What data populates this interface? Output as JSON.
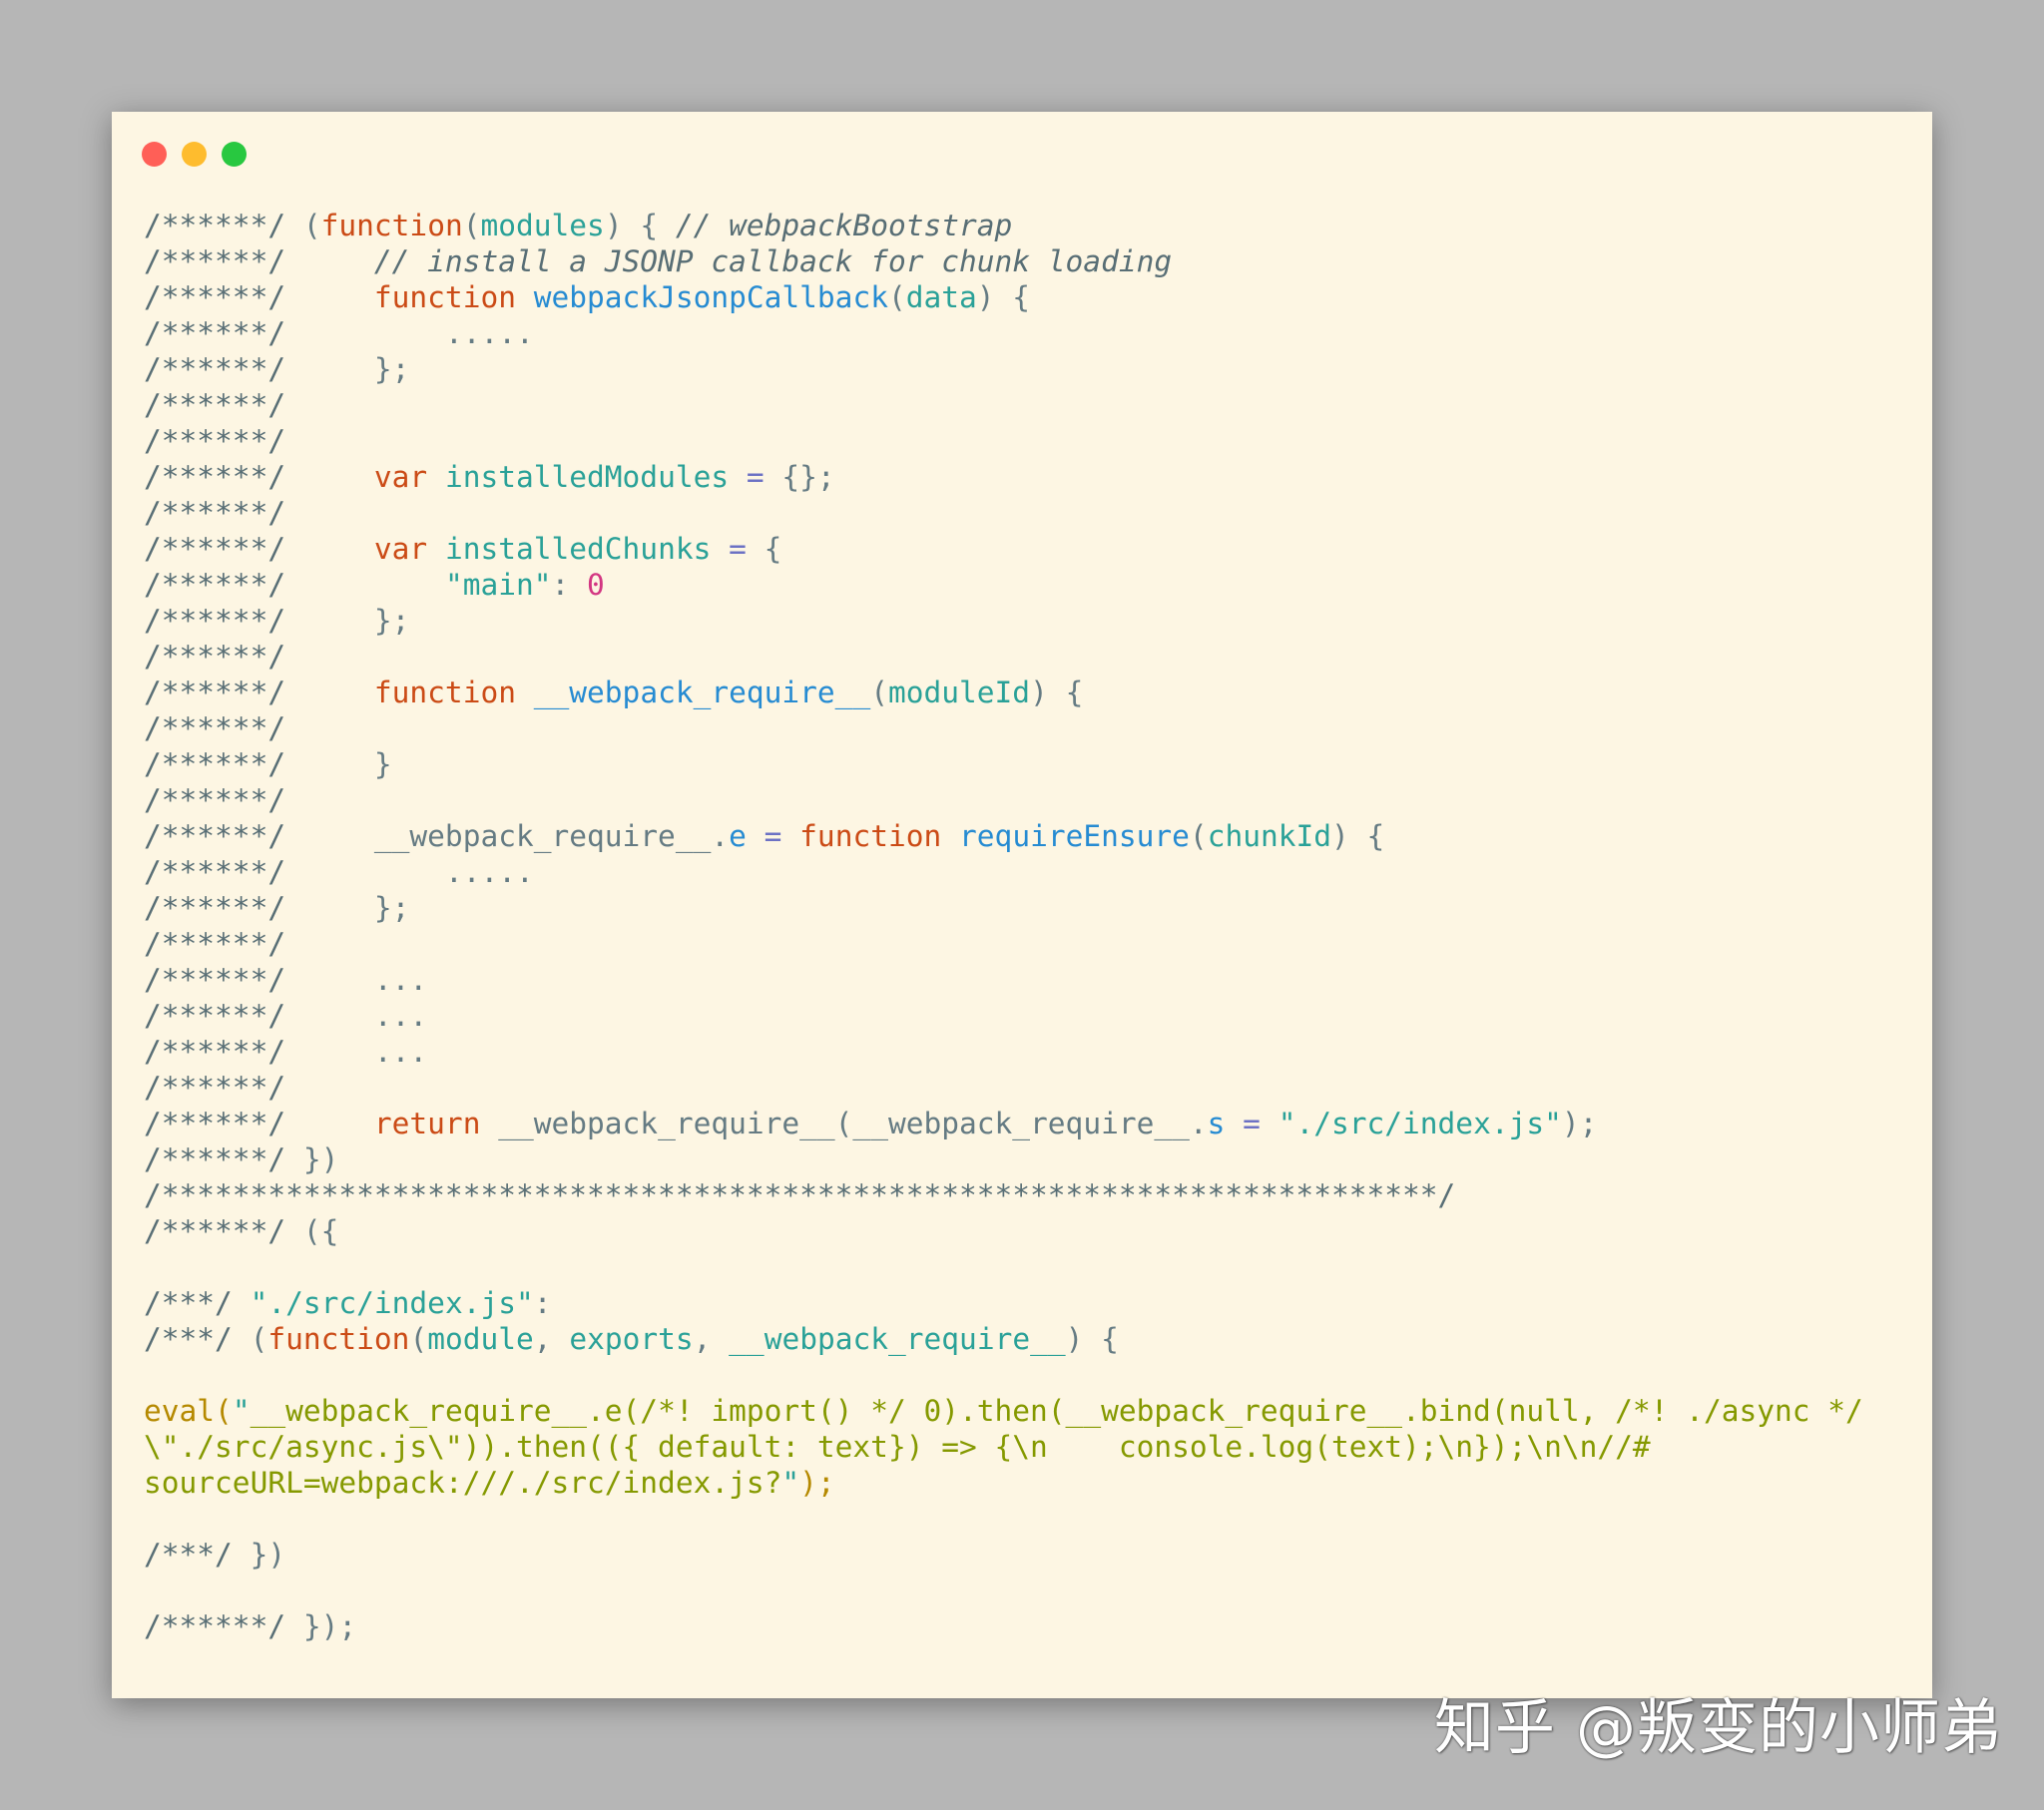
{
  "window": {
    "traffic_lights": [
      {
        "name": "close",
        "color": "#ff5f57"
      },
      {
        "name": "minimize",
        "color": "#febc2e"
      },
      {
        "name": "zoom",
        "color": "#28c840"
      }
    ]
  },
  "code_lines": [
    [
      [
        "c",
        "/******/ "
      ],
      [
        "p",
        "("
      ],
      [
        "k",
        "function"
      ],
      [
        "p",
        "("
      ],
      [
        "v",
        "modules"
      ],
      [
        "p",
        ") { "
      ],
      [
        "ci",
        "// webpackBootstrap"
      ]
    ],
    [
      [
        "c",
        "/******/     "
      ],
      [
        "ci",
        "// install a JSONP callback for chunk loading"
      ]
    ],
    [
      [
        "c",
        "/******/     "
      ],
      [
        "k",
        "function "
      ],
      [
        "f",
        "webpackJsonpCallback"
      ],
      [
        "p",
        "("
      ],
      [
        "v",
        "data"
      ],
      [
        "p",
        ") {"
      ]
    ],
    [
      [
        "c",
        "/******/         "
      ],
      [
        "p",
        "....."
      ]
    ],
    [
      [
        "c",
        "/******/     "
      ],
      [
        "p",
        "};"
      ]
    ],
    [
      [
        "c",
        "/******/"
      ]
    ],
    [
      [
        "c",
        "/******/"
      ]
    ],
    [
      [
        "c",
        "/******/     "
      ],
      [
        "k",
        "var "
      ],
      [
        "v",
        "installedModules"
      ],
      [
        "o",
        " = "
      ],
      [
        "p",
        "{};"
      ]
    ],
    [
      [
        "c",
        "/******/"
      ]
    ],
    [
      [
        "c",
        "/******/     "
      ],
      [
        "k",
        "var "
      ],
      [
        "v",
        "installedChunks"
      ],
      [
        "o",
        " = "
      ],
      [
        "p",
        "{"
      ]
    ],
    [
      [
        "c",
        "/******/         "
      ],
      [
        "s",
        "\"main\""
      ],
      [
        "p",
        ": "
      ],
      [
        "n",
        "0"
      ]
    ],
    [
      [
        "c",
        "/******/     "
      ],
      [
        "p",
        "};"
      ]
    ],
    [
      [
        "c",
        "/******/"
      ]
    ],
    [
      [
        "c",
        "/******/     "
      ],
      [
        "k",
        "function "
      ],
      [
        "f",
        "__webpack_require__"
      ],
      [
        "p",
        "("
      ],
      [
        "v",
        "moduleId"
      ],
      [
        "p",
        ") {"
      ]
    ],
    [
      [
        "c",
        "/******/"
      ]
    ],
    [
      [
        "c",
        "/******/     "
      ],
      [
        "p",
        "}"
      ]
    ],
    [
      [
        "c",
        "/******/"
      ]
    ],
    [
      [
        "c",
        "/******/     "
      ],
      [
        "p",
        "__webpack_require__."
      ],
      [
        "f",
        "e"
      ],
      [
        "o",
        " = "
      ],
      [
        "k",
        "function "
      ],
      [
        "f",
        "requireEnsure"
      ],
      [
        "p",
        "("
      ],
      [
        "v",
        "chunkId"
      ],
      [
        "p",
        ") {"
      ]
    ],
    [
      [
        "c",
        "/******/         "
      ],
      [
        "p",
        "....."
      ]
    ],
    [
      [
        "c",
        "/******/     "
      ],
      [
        "p",
        "};"
      ]
    ],
    [
      [
        "c",
        "/******/"
      ]
    ],
    [
      [
        "c",
        "/******/     "
      ],
      [
        "p",
        "..."
      ]
    ],
    [
      [
        "c",
        "/******/     "
      ],
      [
        "p",
        "..."
      ]
    ],
    [
      [
        "c",
        "/******/     "
      ],
      [
        "p",
        "..."
      ]
    ],
    [
      [
        "c",
        "/******/"
      ]
    ],
    [
      [
        "c",
        "/******/     "
      ],
      [
        "k",
        "return "
      ],
      [
        "p",
        "__webpack_require__(__webpack_require__."
      ],
      [
        "f",
        "s"
      ],
      [
        "o",
        " = "
      ],
      [
        "s",
        "\"./src/index.js\""
      ],
      [
        "p",
        ");"
      ]
    ],
    [
      [
        "c",
        "/******/ "
      ],
      [
        "p",
        "})"
      ]
    ],
    [
      [
        "c",
        "/************************************************************************/"
      ]
    ],
    [
      [
        "c",
        "/******/ "
      ],
      [
        "p",
        "({"
      ]
    ],
    [],
    [
      [
        "c",
        "/***/ "
      ],
      [
        "s",
        "\"./src/index.js\""
      ],
      [
        "p",
        ":"
      ]
    ],
    [
      [
        "c",
        "/***/ "
      ],
      [
        "p",
        "("
      ],
      [
        "k",
        "function"
      ],
      [
        "p",
        "("
      ],
      [
        "v",
        "module"
      ],
      [
        "p",
        ", "
      ],
      [
        "v",
        "exports"
      ],
      [
        "p",
        ", "
      ],
      [
        "v",
        "__webpack_require__"
      ],
      [
        "p",
        ") {"
      ]
    ],
    [],
    [
      [
        "y",
        "eval("
      ],
      [
        "s",
        "\""
      ],
      [
        "g",
        "__webpack_require__.e(/*! import() */ 0).then(__webpack_require__.bind(null, /*! ./async */"
      ]
    ],
    [
      [
        "g",
        "\\\"./src/async.js\\\")).then(({ default: text}) => {\\n    console.log(text);\\n});\\n\\n//#"
      ]
    ],
    [
      [
        "g",
        "sourceURL=webpack:///./src/index.js?"
      ],
      [
        "s",
        "\""
      ],
      [
        "y",
        ");"
      ]
    ],
    [],
    [
      [
        "c",
        "/***/ "
      ],
      [
        "p",
        "})"
      ]
    ],
    [],
    [
      [
        "c",
        "/******/ "
      ],
      [
        "p",
        "});"
      ]
    ]
  ],
  "watermark": {
    "text": "知乎 @叛变的小师弟"
  }
}
